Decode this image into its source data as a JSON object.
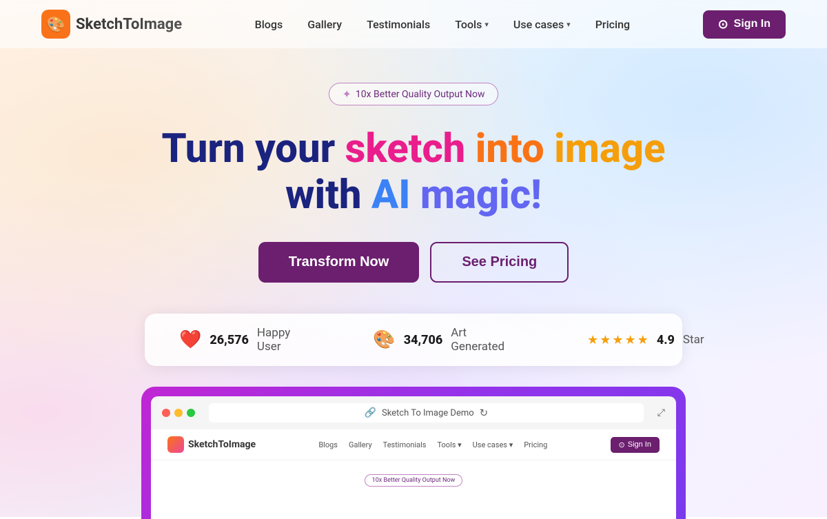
{
  "brand": {
    "name": "SketchToImage",
    "logo_emoji": "🎨"
  },
  "nav": {
    "links": [
      {
        "label": "Blogs",
        "has_dropdown": false
      },
      {
        "label": "Gallery",
        "has_dropdown": false
      },
      {
        "label": "Testimonials",
        "has_dropdown": false
      },
      {
        "label": "Tools",
        "has_dropdown": true
      },
      {
        "label": "Use cases",
        "has_dropdown": true
      },
      {
        "label": "Pricing",
        "has_dropdown": false
      }
    ],
    "sign_in_label": "Sign In"
  },
  "hero": {
    "badge_text": "✦ 10x Better Quality Output Now",
    "headline_line1_word1": "Turn",
    "headline_line1_word2": "your",
    "headline_line1_word3": "sketch",
    "headline_line1_word4": "into",
    "headline_line1_word5": "image",
    "headline_line2_word1": "with",
    "headline_line2_word2": "AI",
    "headline_line2_word3": "magic!",
    "cta_primary": "Transform Now",
    "cta_secondary": "See Pricing"
  },
  "stats": {
    "happy_users_count": "26,576",
    "happy_users_label": "Happy User",
    "art_generated_count": "34,706",
    "art_generated_label": "Art Generated",
    "rating": "4.9",
    "rating_label": "Star"
  },
  "demo": {
    "url_label": "Sketch To Image Demo",
    "badge_text": "10x Better Quality Output Now",
    "nav_links": [
      "Blogs",
      "Gallery",
      "Testimonials",
      "Tools ▾",
      "Use cases ▾",
      "Pricing"
    ],
    "sign_in": "Sign In"
  },
  "colors": {
    "primary": "#6b1f6e",
    "sketch_color": "#e91e8c",
    "into_color": "#f97316",
    "image_color": "#f59e0b",
    "ai_color": "#3b82f6",
    "magic_color": "#6366f1",
    "dark": "#1a237e"
  }
}
